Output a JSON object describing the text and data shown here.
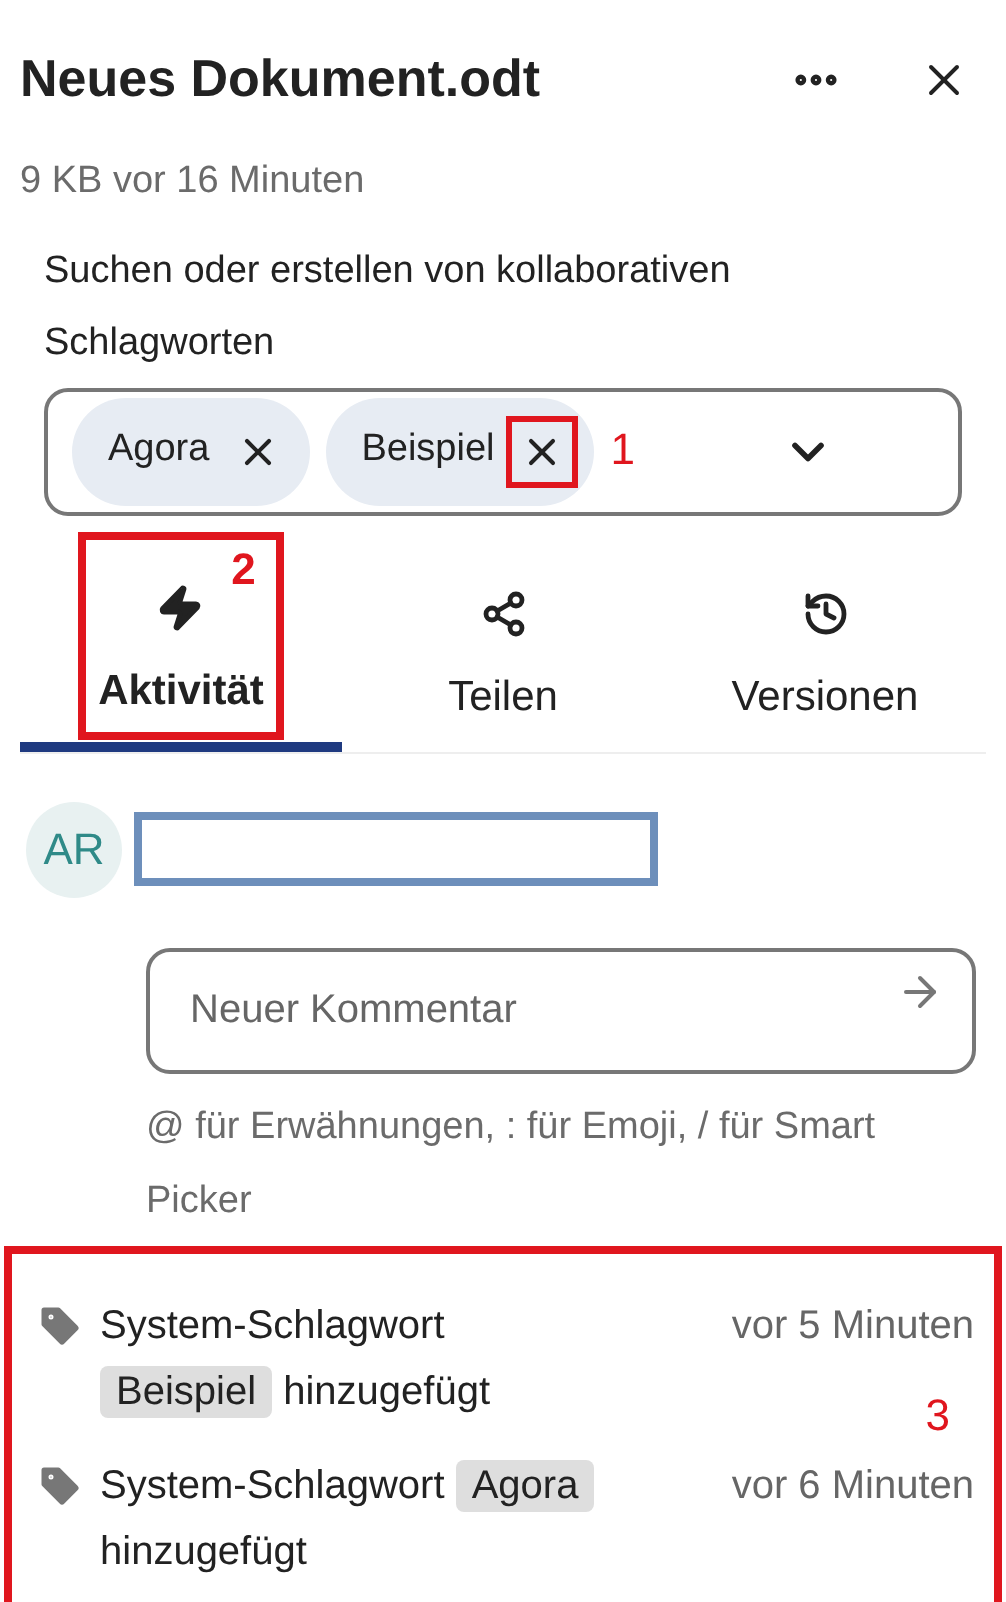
{
  "header": {
    "title": "Neues Dokument.odt",
    "meta": "9 KB vor 16 Minuten"
  },
  "tags": {
    "label": "Suchen oder erstellen von kollaborativen Schlagworten",
    "chips": [
      {
        "label": "Agora"
      },
      {
        "label": "Beispiel",
        "annotation": "1"
      }
    ]
  },
  "tabs": [
    {
      "label": "Aktivität",
      "selected": true,
      "annotation": "2"
    },
    {
      "label": "Teilen",
      "selected": false
    },
    {
      "label": "Versionen",
      "selected": false
    }
  ],
  "comment": {
    "avatar": "AR",
    "placeholder": "Neuer Kommentar",
    "hint": "@ für Erwähnungen, : für Emoji, / für Smart Picker"
  },
  "activity": {
    "annotation": "3",
    "items": [
      {
        "prefix": "System-Schlagwort",
        "tag": "Beispiel",
        "suffix": "hinzugefügt",
        "time": "vor 5 Minuten"
      },
      {
        "prefix": "System-Schlagwort",
        "tag": "Agora",
        "suffix": "hinzugefügt",
        "time": "vor 6 Minuten"
      }
    ]
  }
}
